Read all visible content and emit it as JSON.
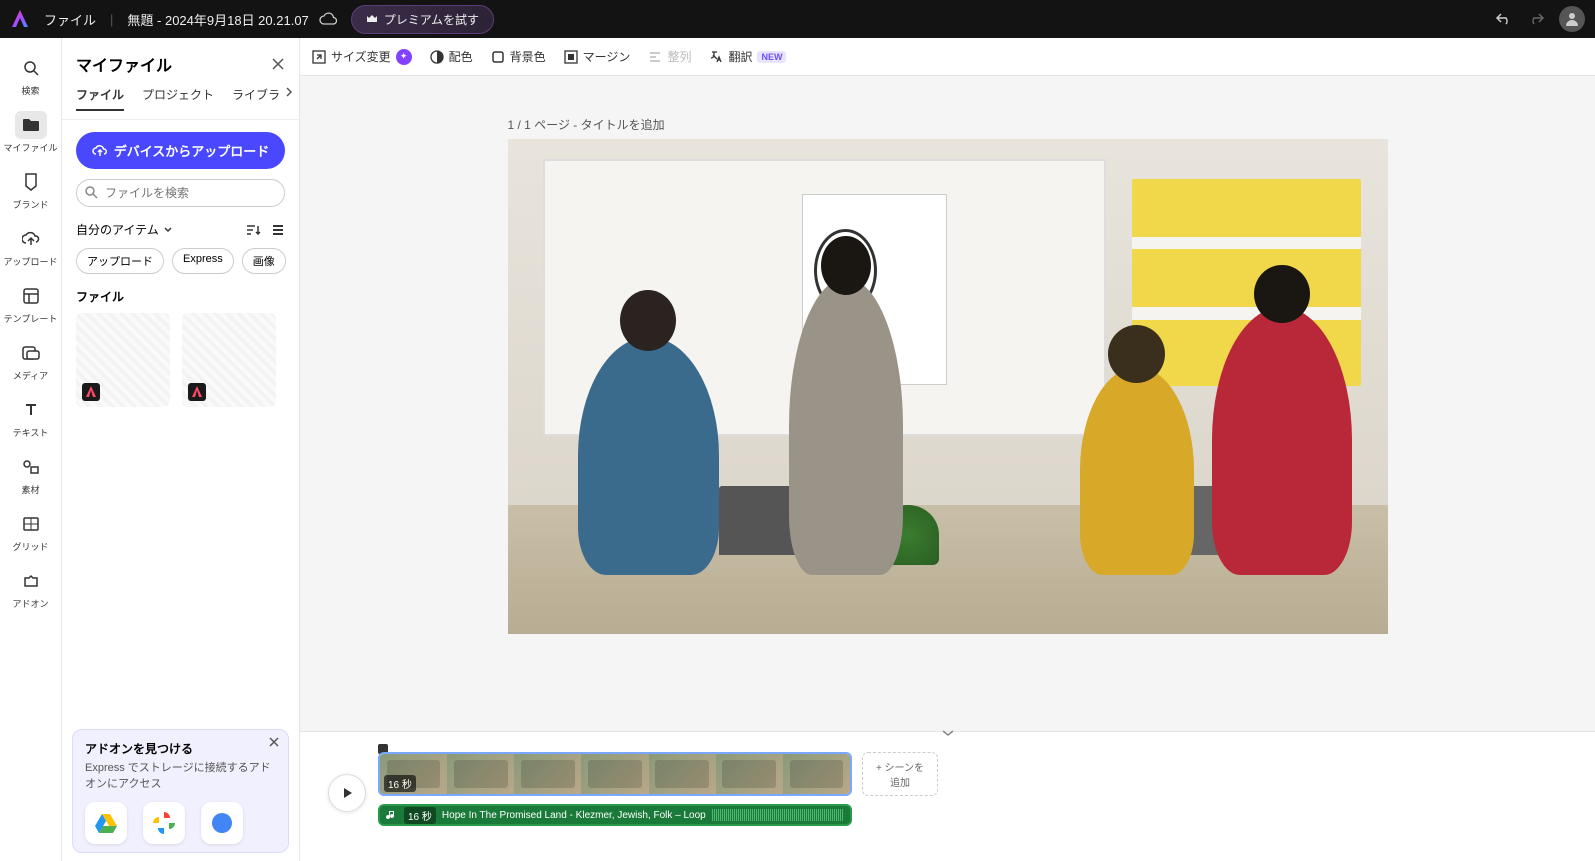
{
  "header": {
    "file_menu": "ファイル",
    "doc_title": "無題 - 2024年9月18日 20.21.07",
    "premium": "プレミアムを試す"
  },
  "rail": [
    {
      "id": "search",
      "label": "検索"
    },
    {
      "id": "myfiles",
      "label": "マイファイル"
    },
    {
      "id": "brand",
      "label": "ブランド"
    },
    {
      "id": "upload",
      "label": "アップロード"
    },
    {
      "id": "template",
      "label": "テンプレート"
    },
    {
      "id": "media",
      "label": "メディア"
    },
    {
      "id": "text",
      "label": "テキスト"
    },
    {
      "id": "asset",
      "label": "素材"
    },
    {
      "id": "grid",
      "label": "グリッド"
    },
    {
      "id": "addon",
      "label": "アドオン"
    }
  ],
  "panel": {
    "title": "マイファイル",
    "tabs": [
      "ファイル",
      "プロジェクト",
      "ライブラ"
    ],
    "upload_btn": "デバイスからアップロード",
    "search_placeholder": "ファイルを検索",
    "my_items": "自分のアイテム",
    "chips": [
      "アップロード",
      "Express",
      "画像"
    ],
    "section_file": "ファイル"
  },
  "addon_card": {
    "title": "アドオンを見つける",
    "desc": "Express でストレージに接続するアドオンにアクセス"
  },
  "toolbar": {
    "resize": "サイズ変更",
    "colors": "配色",
    "bg": "背景色",
    "margin": "マージン",
    "align": "整列",
    "translate": "翻訳",
    "new": "NEW"
  },
  "canvas": {
    "page_label": "1 / 1 ページ - タイトルを追加"
  },
  "timeline": {
    "video_duration": "16 秒",
    "add_scene_1": "+ シーンを",
    "add_scene_2": "追加",
    "audio_duration": "16 秒",
    "audio_title": "Hope In The Promised Land - Klezmer, Jewish, Folk – Loop"
  }
}
